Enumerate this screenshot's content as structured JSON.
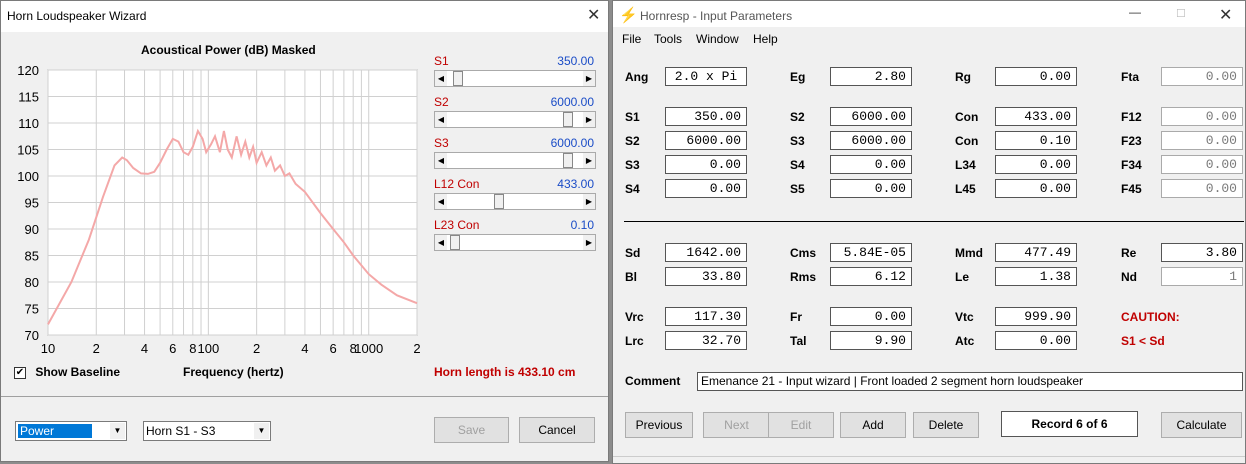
{
  "wizard": {
    "title": "Horn Loudspeaker Wizard",
    "chart_title": "Acoustical Power (dB)   Masked",
    "xlabel": "Frequency (hertz)",
    "show_baseline_label": "Show Baseline",
    "show_baseline_checked": true,
    "horn_length": "Horn length is 433.10 cm",
    "sliders": [
      {
        "name": "S1",
        "value": "350.00",
        "level": 0.05
      },
      {
        "name": "S2",
        "value": "6000.00",
        "level": 0.92
      },
      {
        "name": "S3",
        "value": "6000.00",
        "level": 0.92
      },
      {
        "name": "L12  Con",
        "value": "433.00",
        "level": 0.37
      },
      {
        "name": "L23  Con",
        "value": "0.10",
        "level": 0.02
      }
    ],
    "combo_left": "Power",
    "combo_right": "Horn S1 - S3",
    "save_label": "Save",
    "cancel_label": "Cancel"
  },
  "chart_data": {
    "type": "line",
    "title": "Acoustical Power (dB)   Masked",
    "xlabel": "Frequency (hertz)",
    "ylabel": "",
    "xscale": "log",
    "xlim": [
      10,
      2000
    ],
    "ylim": [
      70,
      120
    ],
    "yticks": [
      "120",
      "115",
      "110",
      "105",
      "100",
      "95",
      "90",
      "85",
      "80",
      "75",
      "70"
    ],
    "xticks": [
      "10",
      "2",
      "4",
      "6",
      "8",
      "100",
      "2",
      "4",
      "6",
      "8",
      "1000",
      "2"
    ],
    "grid": true,
    "series": [
      {
        "color": "#f4a8a8",
        "x": [
          10,
          14,
          18,
          22,
          26,
          29,
          31,
          34,
          38,
          42,
          46,
          50,
          55,
          60,
          65,
          70,
          75,
          80,
          86,
          92,
          97,
          104,
          110,
          118,
          125,
          132,
          140,
          150,
          160,
          170,
          180,
          190,
          200,
          215,
          230,
          245,
          260,
          280,
          300,
          320,
          350,
          400,
          500,
          600,
          700,
          800,
          1000,
          1200,
          1500,
          2000
        ],
        "y": [
          72,
          80,
          88,
          96,
          102,
          103.5,
          103,
          101.5,
          100.5,
          100.4,
          100.8,
          102.5,
          105,
          107,
          106.5,
          104.5,
          104,
          105.5,
          108.5,
          107,
          104.5,
          106,
          107.5,
          104.5,
          108.5,
          105,
          103.5,
          107.5,
          104,
          106.5,
          103.5,
          105.5,
          102.5,
          104.5,
          102,
          103.5,
          101,
          102,
          100,
          100.5,
          98.5,
          97,
          93,
          90,
          87.5,
          85,
          81.5,
          79.5,
          77.5,
          76
        ]
      }
    ]
  },
  "hornresp": {
    "title": "Hornresp - Input Parameters",
    "menu": [
      "File",
      "Tools",
      "Window",
      "Help"
    ],
    "rows": [
      [
        {
          "l": "Ang",
          "v": "2.0 x Pi"
        },
        {
          "l": "Eg",
          "v": "2.80"
        },
        {
          "l": "Rg",
          "v": "0.00"
        },
        {
          "l": "Fta",
          "v": "0.00",
          "g": true
        }
      ],
      [
        {
          "l": "S1",
          "v": "350.00"
        },
        {
          "l": "S2",
          "v": "6000.00"
        },
        {
          "l": "Con",
          "v": "433.00"
        },
        {
          "l": "F12",
          "v": "0.00",
          "g": true
        }
      ],
      [
        {
          "l": "S2",
          "v": "6000.00"
        },
        {
          "l": "S3",
          "v": "6000.00"
        },
        {
          "l": "Con",
          "v": "0.10"
        },
        {
          "l": "F23",
          "v": "0.00",
          "g": true
        }
      ],
      [
        {
          "l": "S3",
          "v": "0.00"
        },
        {
          "l": "S4",
          "v": "0.00"
        },
        {
          "l": "L34",
          "v": "0.00"
        },
        {
          "l": "F34",
          "v": "0.00",
          "g": true
        }
      ],
      [
        {
          "l": "S4",
          "v": "0.00"
        },
        {
          "l": "S5",
          "v": "0.00"
        },
        {
          "l": "L45",
          "v": "0.00"
        },
        {
          "l": "F45",
          "v": "0.00",
          "g": true
        }
      ],
      [
        {
          "l": "Sd",
          "v": "1642.00"
        },
        {
          "l": "Cms",
          "v": "5.84E-05"
        },
        {
          "l": "Mmd",
          "v": "477.49"
        },
        {
          "l": "Re",
          "v": "3.80"
        }
      ],
      [
        {
          "l": "Bl",
          "v": "33.80"
        },
        {
          "l": "Rms",
          "v": "6.12"
        },
        {
          "l": "Le",
          "v": "1.38"
        },
        {
          "l": "Nd",
          "v": "1",
          "g": true
        }
      ],
      [
        {
          "l": "Vrc",
          "v": "117.30"
        },
        {
          "l": "Fr",
          "v": "0.00"
        },
        {
          "l": "Vtc",
          "v": "999.90"
        }
      ],
      [
        {
          "l": "Lrc",
          "v": "32.70"
        },
        {
          "l": "Tal",
          "v": "9.90"
        },
        {
          "l": "Atc",
          "v": "0.00"
        }
      ]
    ],
    "caution_label": "CAUTION:",
    "caution_text": "S1 < Sd",
    "comment_label": "Comment",
    "comment_value": "Emenance 21 - Input wizard | Front loaded 2 segment horn loudspeaker",
    "buttons": {
      "previous": "Previous",
      "next": "Next",
      "edit": "Edit",
      "add": "Add",
      "delete": "Delete",
      "record": "Record 6 of 6",
      "calculate": "Calculate"
    }
  }
}
